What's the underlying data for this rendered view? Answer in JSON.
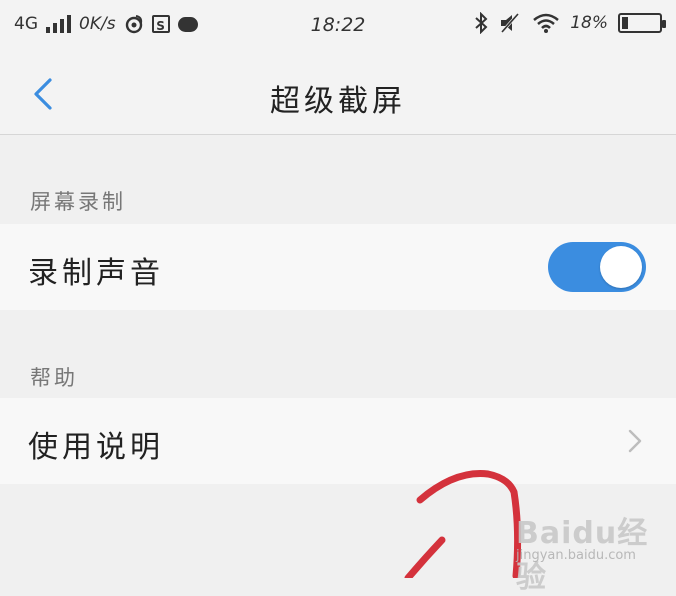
{
  "status_bar": {
    "network": "4G",
    "speed": "0K/s",
    "time": "18:22",
    "battery": "18%",
    "battery_level": 0.18,
    "icons": [
      "signal-icon",
      "weibo-icon",
      "s-box-icon",
      "chat-icon",
      "bluetooth-icon",
      "mute-icon",
      "wifi-icon",
      "battery-icon"
    ]
  },
  "nav": {
    "title": "超级截屏"
  },
  "sections": [
    {
      "header": "屏幕录制",
      "row_label": "录制声音",
      "toggle_on": true
    },
    {
      "header": "帮助",
      "row_label": "使用说明"
    }
  ],
  "watermark": {
    "brand": "Baidu经验",
    "url": "jingyan.baidu.com"
  },
  "colors": {
    "accent": "#3b8de0",
    "annotation": "#d4323c"
  }
}
